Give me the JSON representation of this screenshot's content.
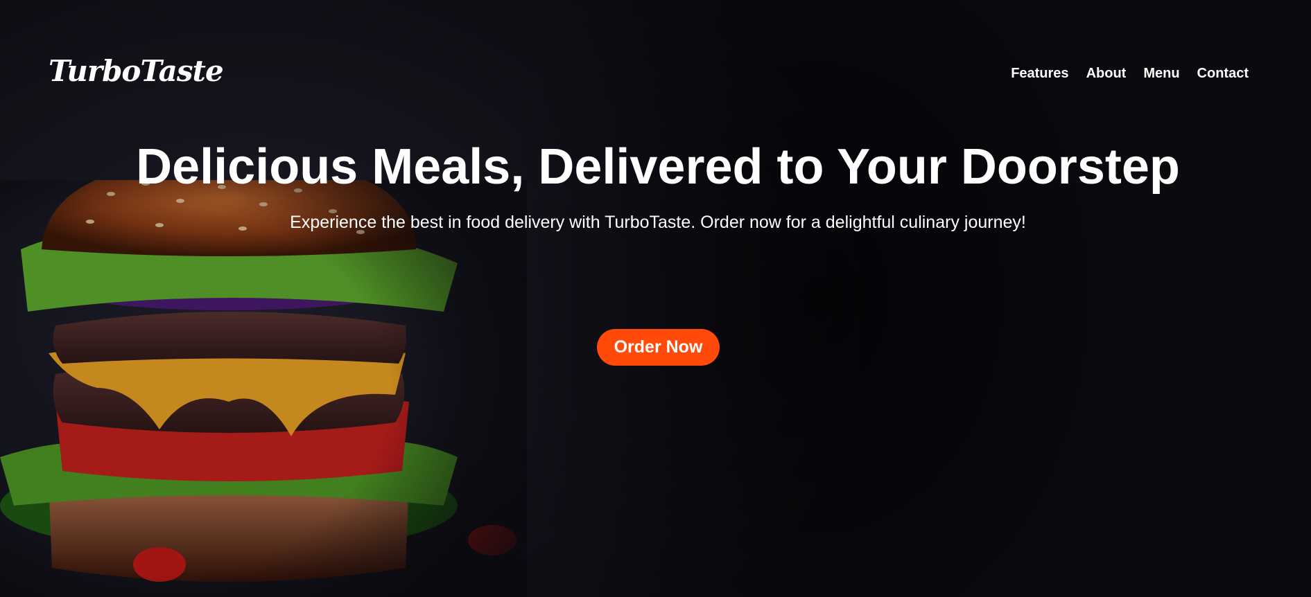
{
  "brand": {
    "logo_text": "TurboTaste"
  },
  "nav": {
    "items": [
      "Features",
      "About",
      "Menu",
      "Contact"
    ]
  },
  "hero": {
    "title": "Delicious Meals, Delivered to Your Doorstep",
    "subtitle": "Experience the best in food delivery with TurboTaste. Order now for a delightful culinary journey!",
    "cta_label": "Order Now"
  },
  "colors": {
    "accent": "#ff4a0a",
    "background": "#0c0c12",
    "text": "#ffffff"
  }
}
